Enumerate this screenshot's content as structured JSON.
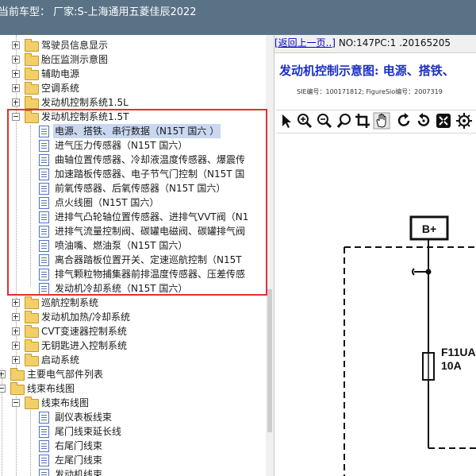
{
  "window": {
    "title": "当前车型：  厂家:S-上海通用五菱佳辰2022"
  },
  "tree": {
    "nodes": [
      {
        "label": "驾驶员信息显示"
      },
      {
        "label": "胎压监测示意图"
      },
      {
        "label": "辅助电源"
      },
      {
        "label": "空调系统"
      },
      {
        "label": "发动机控制系统1.5L"
      },
      {
        "label": "发动机控制系统1.5T"
      },
      {
        "label": "电源、搭铁、串行数据（N15T 国六 ）"
      },
      {
        "label": "进气压力传感器（N15T 国六）"
      },
      {
        "label": "曲轴位置传感器、冷却液温度传感器、爆震传"
      },
      {
        "label": "加速踏板传感器、电子节气门控制（N15T 国"
      },
      {
        "label": "前氧传感器、后氧传感器（N15T 国六）"
      },
      {
        "label": "点火线圈（N15T 国六）"
      },
      {
        "label": "进排气凸轮轴位置传感器、进排气VVT阀（N1"
      },
      {
        "label": "进排气流量控制阀、碳罐电磁阀、碳罐排气阀"
      },
      {
        "label": "喷油嘴、燃油泵（N15T 国六）"
      },
      {
        "label": "离合器踏板位置开关、定速巡航控制（N15T"
      },
      {
        "label": "排气颗粒物捕集器前排温度传感器、压差传感"
      },
      {
        "label": "发动机冷却系统（N15T 国六）"
      },
      {
        "label": "巡航控制系统"
      },
      {
        "label": "发动机加热/冷却系统"
      },
      {
        "label": "CVT变速器控制系统"
      },
      {
        "label": "无钥匙进入控制系统"
      },
      {
        "label": "启动系统"
      },
      {
        "label": "主要电气部件列表"
      },
      {
        "label": "线束布线图"
      },
      {
        "label": "线束布线图"
      },
      {
        "label": "副仪表板线束"
      },
      {
        "label": "尾门线束延长线"
      },
      {
        "label": "右尾门线束"
      },
      {
        "label": "左尾门线束"
      },
      {
        "label": "发动机线束"
      }
    ]
  },
  "document": {
    "back_link": "[返回上一页..]",
    "nav_info": "NO:147PC:1 .20165205",
    "title": "发动机控制示意图: 电源、搭铁、",
    "meta": "SIE编号：100171812;  FigureSio编号：2007319",
    "toolbar_icons": [
      "pointer-icon",
      "zoom-in-icon",
      "zoom-out-icon",
      "zoom-window-icon",
      "crop-icon",
      "pan-hand-icon",
      "rotate-icon",
      "reset-icon",
      "fit-icon",
      "settings-icon"
    ],
    "diagram": {
      "connector_label": "B+",
      "fuse_label": "F11UA",
      "fuse_rating": "10A"
    }
  },
  "colors": {
    "title_bar": "#5a7286",
    "highlight_box": "#e03131",
    "selected_row": "#c9d7f0",
    "doc_title": "#1b2fc4"
  }
}
